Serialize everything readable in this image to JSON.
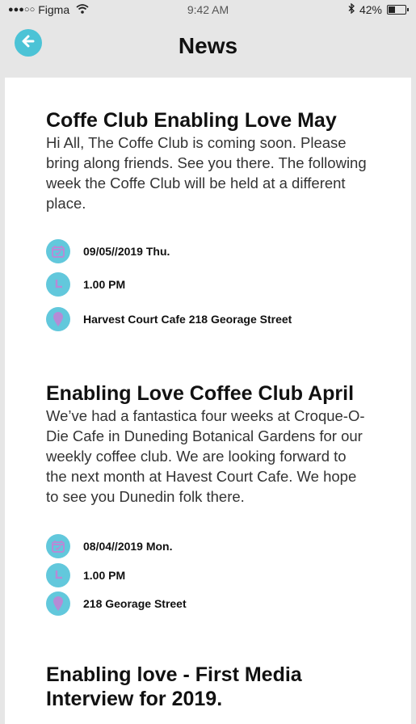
{
  "status_bar": {
    "carrier": "Figma",
    "time": "9:42 AM",
    "battery": "42%",
    "battery_level": 0.42
  },
  "header": {
    "title": "News",
    "back_icon": "arrow-left-icon"
  },
  "colors": {
    "accent": "#4cc3d6",
    "icon_glyph": "#b58bd6",
    "background": "#e6e6e6"
  },
  "articles": [
    {
      "title": "Coffe Club Enabling Love May",
      "body": "Hi All, The Coffe Club is coming soon. Please bring along friends. See you there. The following week the Coffe Club will be held at a  different place.",
      "date": "09/05//2019 Thu.",
      "time": "1.00 PM",
      "location": "Harvest Court Cafe 218 Georage Street"
    },
    {
      "title": "Enabling Love Coffee Club April",
      "body": "We’ve had a fantastica four weeks at Croque-O-Die Cafe in Duneding Botanical Gardens for our weekly coffee club. We are looking forward to the next month at Havest Court Cafe. We hope to see you Dunedin folk there.",
      "date": "08/04//2019 Mon.",
      "time": "1.00 PM",
      "location": "218 Georage Street"
    },
    {
      "title": "Enabling love - First Media Interview for 2019."
    }
  ]
}
